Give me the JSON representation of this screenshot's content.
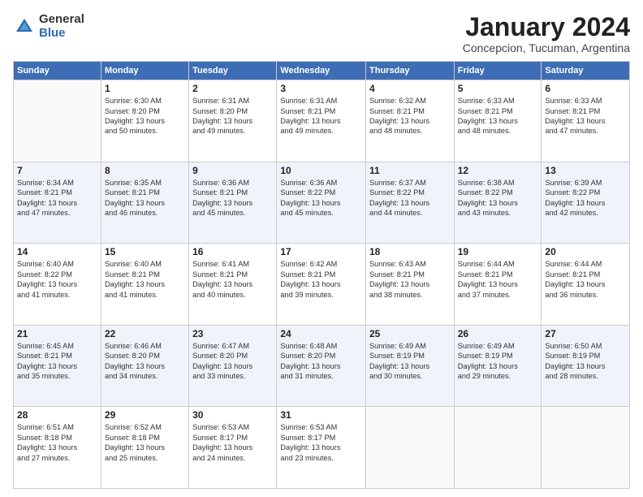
{
  "logo": {
    "general": "General",
    "blue": "Blue"
  },
  "header": {
    "month": "January 2024",
    "location": "Concepcion, Tucuman, Argentina"
  },
  "weekdays": [
    "Sunday",
    "Monday",
    "Tuesday",
    "Wednesday",
    "Thursday",
    "Friday",
    "Saturday"
  ],
  "weeks": [
    [
      {
        "day": "",
        "info": ""
      },
      {
        "day": "1",
        "info": "Sunrise: 6:30 AM\nSunset: 8:20 PM\nDaylight: 13 hours\nand 50 minutes."
      },
      {
        "day": "2",
        "info": "Sunrise: 6:31 AM\nSunset: 8:20 PM\nDaylight: 13 hours\nand 49 minutes."
      },
      {
        "day": "3",
        "info": "Sunrise: 6:31 AM\nSunset: 8:21 PM\nDaylight: 13 hours\nand 49 minutes."
      },
      {
        "day": "4",
        "info": "Sunrise: 6:32 AM\nSunset: 8:21 PM\nDaylight: 13 hours\nand 48 minutes."
      },
      {
        "day": "5",
        "info": "Sunrise: 6:33 AM\nSunset: 8:21 PM\nDaylight: 13 hours\nand 48 minutes."
      },
      {
        "day": "6",
        "info": "Sunrise: 6:33 AM\nSunset: 8:21 PM\nDaylight: 13 hours\nand 47 minutes."
      }
    ],
    [
      {
        "day": "7",
        "info": "Sunrise: 6:34 AM\nSunset: 8:21 PM\nDaylight: 13 hours\nand 47 minutes."
      },
      {
        "day": "8",
        "info": "Sunrise: 6:35 AM\nSunset: 8:21 PM\nDaylight: 13 hours\nand 46 minutes."
      },
      {
        "day": "9",
        "info": "Sunrise: 6:36 AM\nSunset: 8:21 PM\nDaylight: 13 hours\nand 45 minutes."
      },
      {
        "day": "10",
        "info": "Sunrise: 6:36 AM\nSunset: 8:22 PM\nDaylight: 13 hours\nand 45 minutes."
      },
      {
        "day": "11",
        "info": "Sunrise: 6:37 AM\nSunset: 8:22 PM\nDaylight: 13 hours\nand 44 minutes."
      },
      {
        "day": "12",
        "info": "Sunrise: 6:38 AM\nSunset: 8:22 PM\nDaylight: 13 hours\nand 43 minutes."
      },
      {
        "day": "13",
        "info": "Sunrise: 6:39 AM\nSunset: 8:22 PM\nDaylight: 13 hours\nand 42 minutes."
      }
    ],
    [
      {
        "day": "14",
        "info": "Sunrise: 6:40 AM\nSunset: 8:22 PM\nDaylight: 13 hours\nand 41 minutes."
      },
      {
        "day": "15",
        "info": "Sunrise: 6:40 AM\nSunset: 8:21 PM\nDaylight: 13 hours\nand 41 minutes."
      },
      {
        "day": "16",
        "info": "Sunrise: 6:41 AM\nSunset: 8:21 PM\nDaylight: 13 hours\nand 40 minutes."
      },
      {
        "day": "17",
        "info": "Sunrise: 6:42 AM\nSunset: 8:21 PM\nDaylight: 13 hours\nand 39 minutes."
      },
      {
        "day": "18",
        "info": "Sunrise: 6:43 AM\nSunset: 8:21 PM\nDaylight: 13 hours\nand 38 minutes."
      },
      {
        "day": "19",
        "info": "Sunrise: 6:44 AM\nSunset: 8:21 PM\nDaylight: 13 hours\nand 37 minutes."
      },
      {
        "day": "20",
        "info": "Sunrise: 6:44 AM\nSunset: 8:21 PM\nDaylight: 13 hours\nand 36 minutes."
      }
    ],
    [
      {
        "day": "21",
        "info": "Sunrise: 6:45 AM\nSunset: 8:21 PM\nDaylight: 13 hours\nand 35 minutes."
      },
      {
        "day": "22",
        "info": "Sunrise: 6:46 AM\nSunset: 8:20 PM\nDaylight: 13 hours\nand 34 minutes."
      },
      {
        "day": "23",
        "info": "Sunrise: 6:47 AM\nSunset: 8:20 PM\nDaylight: 13 hours\nand 33 minutes."
      },
      {
        "day": "24",
        "info": "Sunrise: 6:48 AM\nSunset: 8:20 PM\nDaylight: 13 hours\nand 31 minutes."
      },
      {
        "day": "25",
        "info": "Sunrise: 6:49 AM\nSunset: 8:19 PM\nDaylight: 13 hours\nand 30 minutes."
      },
      {
        "day": "26",
        "info": "Sunrise: 6:49 AM\nSunset: 8:19 PM\nDaylight: 13 hours\nand 29 minutes."
      },
      {
        "day": "27",
        "info": "Sunrise: 6:50 AM\nSunset: 8:19 PM\nDaylight: 13 hours\nand 28 minutes."
      }
    ],
    [
      {
        "day": "28",
        "info": "Sunrise: 6:51 AM\nSunset: 8:18 PM\nDaylight: 13 hours\nand 27 minutes."
      },
      {
        "day": "29",
        "info": "Sunrise: 6:52 AM\nSunset: 8:18 PM\nDaylight: 13 hours\nand 25 minutes."
      },
      {
        "day": "30",
        "info": "Sunrise: 6:53 AM\nSunset: 8:17 PM\nDaylight: 13 hours\nand 24 minutes."
      },
      {
        "day": "31",
        "info": "Sunrise: 6:53 AM\nSunset: 8:17 PM\nDaylight: 13 hours\nand 23 minutes."
      },
      {
        "day": "",
        "info": ""
      },
      {
        "day": "",
        "info": ""
      },
      {
        "day": "",
        "info": ""
      }
    ]
  ]
}
